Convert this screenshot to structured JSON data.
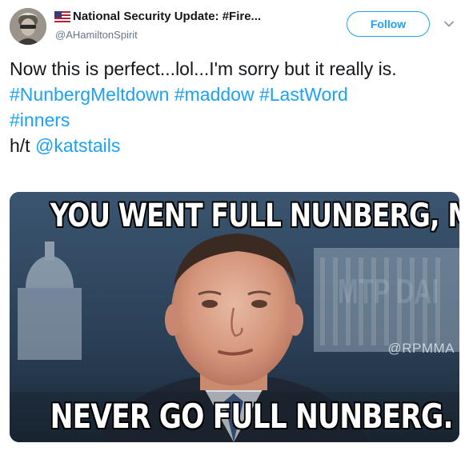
{
  "author": {
    "display_name": "National Security Update: #Fire...",
    "handle": "@AHamiltonSpirit",
    "name_icon": "us-flag-icon"
  },
  "follow_button": {
    "label": "Follow"
  },
  "menu": {
    "icon": "chevron-down-icon"
  },
  "tweet": {
    "line1": "Now this is perfect...lol...I'm sorry but it really is.",
    "hashtags": [
      "#NunbergMeltdown",
      "#maddow",
      "#LastWord",
      "#inners"
    ],
    "hat_tip_prefix": "h/t",
    "mention": "@katstails"
  },
  "media": {
    "top_caption": "YOU WENT FULL NUNBERG, MAN.",
    "bottom_caption": "NEVER GO FULL NUNBERG.",
    "watermark": "@RPMMA",
    "background_text": "MTP DAI"
  },
  "colors": {
    "link": "#1da1f2",
    "text": "#14171a",
    "secondary": "#657786"
  }
}
